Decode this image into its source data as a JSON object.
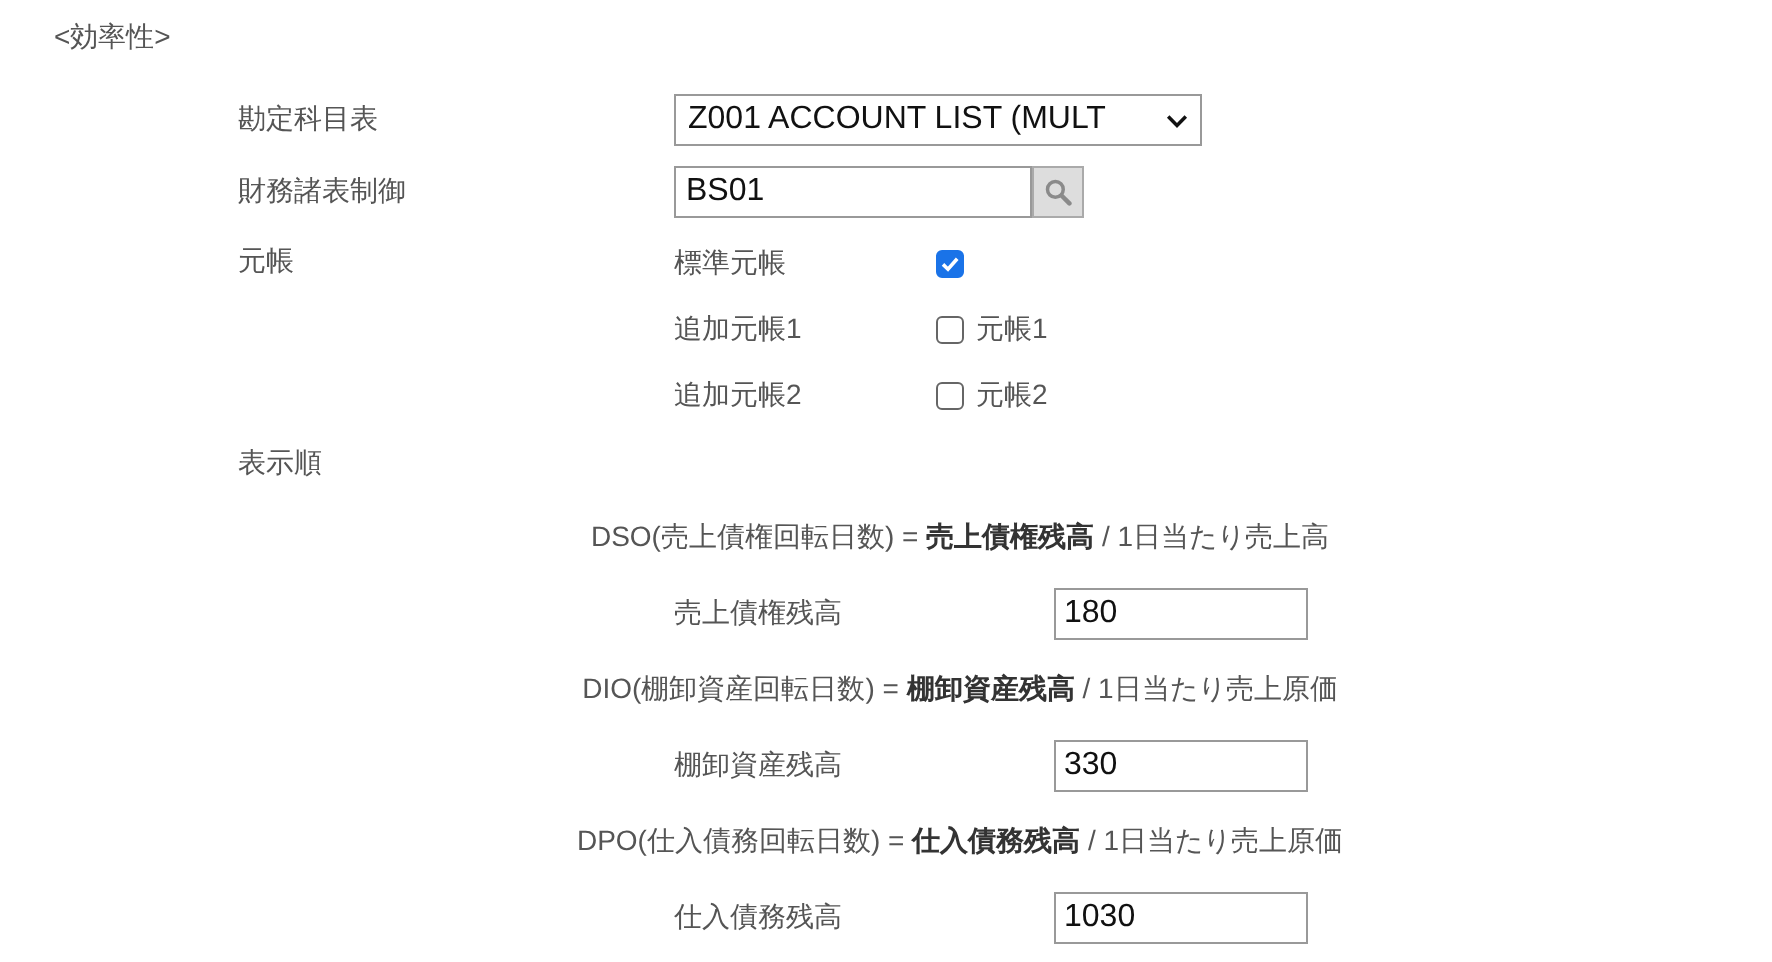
{
  "section_title": "<効率性>",
  "chart_of_accounts": {
    "label": "勘定科目表",
    "value": "Z001 ACCOUNT LIST (MULT"
  },
  "fs_version": {
    "label": "財務諸表制御",
    "value": "BS01"
  },
  "ledgers": {
    "label": "元帳",
    "items": [
      {
        "label": "標準元帳",
        "checked": true
      },
      {
        "label": "追加元帳1",
        "checked": false,
        "option": "元帳1"
      },
      {
        "label": "追加元帳2",
        "checked": false,
        "option": "元帳2"
      }
    ]
  },
  "display_order": {
    "label": "表示順"
  },
  "metrics": [
    {
      "formula": "DSO(売上債権回転日数) = **売上債権残高** / 1日当たり売上高",
      "field_label": "売上債権残高",
      "value": "180"
    },
    {
      "formula": "DIO(棚卸資産回転日数) = **棚卸資産残高** / 1日当たり売上原価",
      "field_label": "棚卸資産残高",
      "value": "330"
    },
    {
      "formula": "DPO(仕入債務回転日数) = **仕入債務残高** / 1日当たり売上原価",
      "field_label": "仕入債務残高",
      "value": "1030"
    }
  ]
}
